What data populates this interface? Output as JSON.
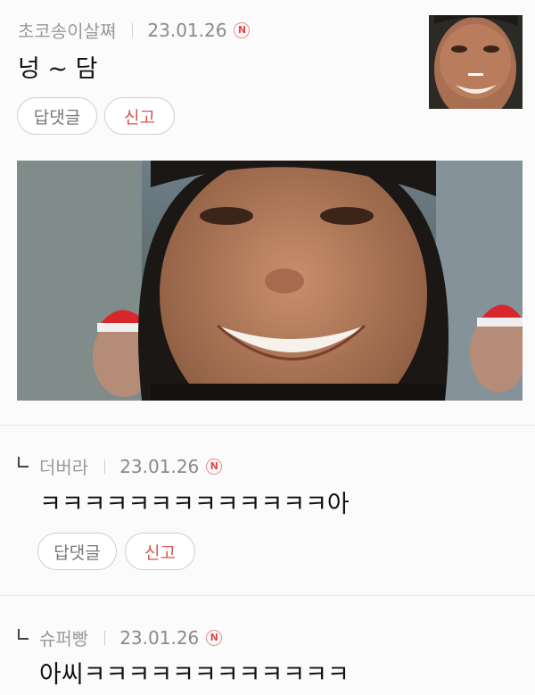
{
  "comments": [
    {
      "author": "초코송이살쪄",
      "date": "23.01.26",
      "new_badge": "N",
      "text": "넝 ~ 담",
      "reply_label": "답댓글",
      "report_label": "신고"
    },
    {
      "author": "더버라",
      "date": "23.01.26",
      "new_badge": "N",
      "text": "ㅋㅋㅋㅋㅋㅋㅋㅋㅋㅋㅋㅋㅋ아",
      "reply_label": "답댓글",
      "report_label": "신고"
    },
    {
      "author": "슈퍼빵",
      "date": "23.01.26",
      "new_badge": "N",
      "text": "아씨ㅋㅋㅋㅋㅋㅋㅋㅋㅋㅋㅋㅋ"
    }
  ],
  "colors": {
    "new_badge": "#e04a4a",
    "report_text": "#d9534f"
  }
}
